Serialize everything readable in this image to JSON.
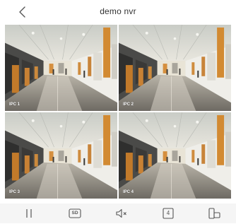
{
  "header": {
    "title": "demo nvr",
    "back_icon": "chevron-left-icon"
  },
  "cameras": [
    {
      "label": "IPC 1"
    },
    {
      "label": "IPC 2"
    },
    {
      "label": "IPC 3"
    },
    {
      "label": "IPC 4"
    }
  ],
  "toolbar": {
    "pause_icon": "pause-icon",
    "quality_label": "SD",
    "mute_icon": "speaker-muted-icon",
    "split_count": "4",
    "rotate_icon": "rotate-screen-icon"
  },
  "colors": {
    "toolbar_bg": "#f5f5f5",
    "icon": "#555555",
    "title": "#333333"
  }
}
